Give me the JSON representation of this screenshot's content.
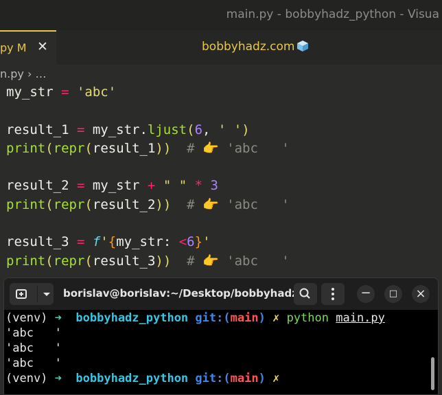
{
  "window": {
    "title": "main.py - bobbyhadz_python - Visua"
  },
  "tab": {
    "label": "py M",
    "close": "✕",
    "indicator_color": "#e6c84e"
  },
  "banner": {
    "text": "bobbyhadz.com"
  },
  "breadcrumb": {
    "file": "n.py",
    "sep": "›",
    "more": "…"
  },
  "code": {
    "l1": {
      "var": "my_str",
      "eq": " = ",
      "str": "'abc'"
    },
    "l3": {
      "var": "result_1",
      "eq": " = ",
      "obj": "my_str.",
      "fn": "ljust",
      "open": "(",
      "num": "6",
      "comma": ", ",
      "str": "' '",
      "close": ")"
    },
    "l4": {
      "fn": "print",
      "o1": "(",
      "fn2": "repr",
      "o2": "(",
      "arg": "result_1",
      "c": "))",
      "hash": "  # ",
      "emoji": "👉",
      "out": " 'abc   '"
    },
    "l6": {
      "var": "result_2",
      "eq": " = ",
      "obj": "my_str",
      "plus": " + ",
      "str": "\" \"",
      "times": " * ",
      "num": "3"
    },
    "l7": {
      "fn": "print",
      "o1": "(",
      "fn2": "repr",
      "o2": "(",
      "arg": "result_2",
      "c": "))",
      "hash": "  # ",
      "emoji": "👉",
      "out": " 'abc   '"
    },
    "l9": {
      "var": "result_3",
      "eq": " = ",
      "f": "f",
      "q1": "'",
      "b1": "{",
      "inner": "my_str: ",
      "lt": "<",
      "num": "6",
      "b2": "}",
      "q2": "'"
    },
    "l10": {
      "fn": "print",
      "o1": "(",
      "fn2": "repr",
      "o2": "(",
      "arg": "result_3",
      "c": "))",
      "hash": "  # ",
      "emoji": "👉",
      "out": " 'abc   '"
    }
  },
  "terminal": {
    "title": "borislav@borislav:~/Desktop/bobbyhadz_...",
    "buttons": {
      "minimize": "−",
      "maximize": "□",
      "close": "×"
    },
    "prompt": {
      "venv": "(venv)",
      "arrow": "➜",
      "dir": "bobbyhadz_python",
      "git": "git:(",
      "branch": "main",
      "git_close": ")",
      "x": "✗"
    },
    "command": {
      "cmd": "python",
      "arg": "main.py"
    },
    "output": [
      "'abc   '",
      "'abc   '",
      "'abc   '"
    ]
  }
}
